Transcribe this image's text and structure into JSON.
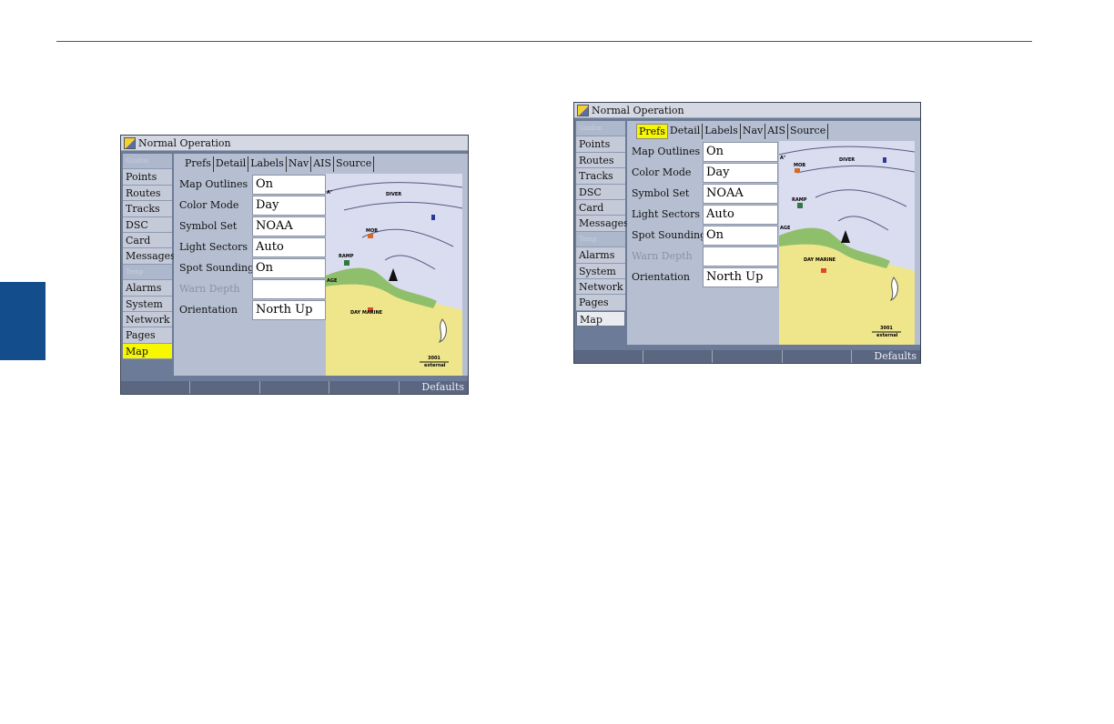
{
  "colors": {
    "page_tab": "#144d8c",
    "highlight": "#f7f700",
    "land": "#efe68c",
    "shore": "#8fbf6a",
    "water": "#dadcf0"
  },
  "screens": [
    {
      "title": "Normal Operation",
      "menu": [
        "Guidon",
        "Points",
        "Routes",
        "Tracks",
        "DSC",
        "Card",
        "Messages",
        "Temp",
        "Alarms",
        "System",
        "Network",
        "Pages",
        "Map"
      ],
      "tabs": [
        "Prefs",
        "Detail",
        "Labels",
        "Nav",
        "AIS",
        "Source"
      ],
      "fields": [
        {
          "label": "Map Outlines",
          "value": "On"
        },
        {
          "label": "Color Mode",
          "value": "Day"
        },
        {
          "label": "Symbol Set",
          "value": "NOAA"
        },
        {
          "label": "Light Sectors",
          "value": "Auto"
        },
        {
          "label": "Spot Soundings",
          "value": "On"
        },
        {
          "label": "Warn Depth",
          "value": ""
        },
        {
          "label": "Orientation",
          "value": "North Up"
        }
      ],
      "map_labels": {
        "diver": "DIVER",
        "mob": "MOB",
        "ramp": "RAMP",
        "day_marine": "DAY MARINE",
        "left_edge": "AGE",
        "left_edge2": "A\"",
        "scale": "3001",
        "source": "external"
      },
      "softkeys": [
        "",
        "",
        "",
        "",
        "Defaults"
      ]
    },
    {
      "title": "Normal Operation",
      "menu": [
        "Guidon",
        "Points",
        "Routes",
        "Tracks",
        "DSC",
        "Card",
        "Messages",
        "Temp",
        "Alarms",
        "System",
        "Network",
        "Pages",
        "Map"
      ],
      "tabs": [
        "Prefs",
        "Detail",
        "Labels",
        "Nav",
        "AIS",
        "Source"
      ],
      "fields": [
        {
          "label": "Map Outlines",
          "value": "On"
        },
        {
          "label": "Color Mode",
          "value": "Day"
        },
        {
          "label": "Symbol Set",
          "value": "NOAA"
        },
        {
          "label": "Light Sectors",
          "value": "Auto"
        },
        {
          "label": "Spot Soundings",
          "value": "On"
        },
        {
          "label": "Warn Depth",
          "value": ""
        },
        {
          "label": "Orientation",
          "value": "North Up"
        }
      ],
      "map_labels": {
        "diver": "DIVER",
        "mob": "MOB",
        "ramp": "RAMP",
        "day_marine": "DAY MARINE",
        "left_edge": "AGE",
        "left_edge2": "A\"",
        "scale": "3001",
        "source": "external"
      },
      "softkeys": [
        "",
        "",
        "",
        "",
        "Defaults"
      ]
    }
  ]
}
